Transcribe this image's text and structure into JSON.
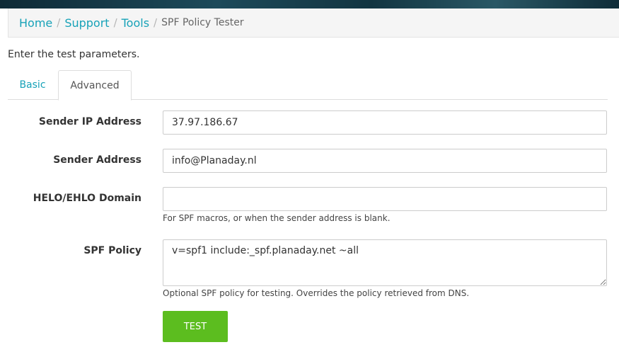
{
  "breadcrumb": {
    "items": [
      "Home",
      "Support",
      "Tools"
    ],
    "current": "SPF Policy Tester",
    "separator": "/"
  },
  "intro_text": "Enter the test parameters.",
  "tabs": [
    {
      "label": "Basic",
      "active": false
    },
    {
      "label": "Advanced",
      "active": true
    }
  ],
  "form": {
    "sender_ip": {
      "label": "Sender IP Address",
      "value": "37.97.186.67"
    },
    "sender_address": {
      "label": "Sender Address",
      "value": "info@Planaday.nl"
    },
    "helo_domain": {
      "label": "HELO/EHLO Domain",
      "value": "",
      "help": "For SPF macros, or when the sender address is blank."
    },
    "spf_policy": {
      "label": "SPF Policy",
      "value": "v=spf1 include:_spf.planaday.net ~all",
      "help": "Optional SPF policy for testing. Overrides the policy retrieved from DNS."
    }
  },
  "test_button": {
    "label": "TEST"
  },
  "colors": {
    "link": "#17a2b8",
    "button": "#5cbd1f"
  }
}
